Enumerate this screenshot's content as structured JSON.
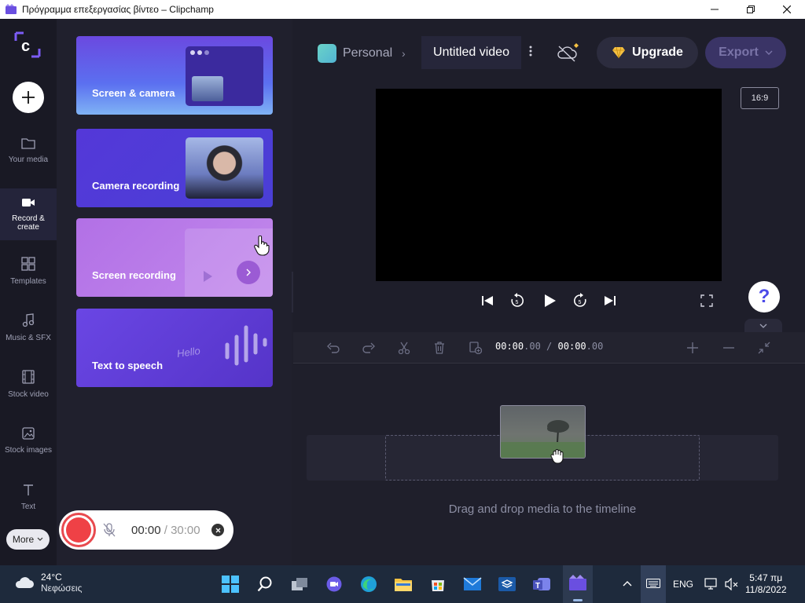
{
  "window": {
    "title": "Πρόγραμμα επεξεργασίας βίντεο – Clipchamp"
  },
  "nav": {
    "items": [
      {
        "label": "Your media",
        "icon": "folder-icon"
      },
      {
        "label_line1": "Record &",
        "label_line2": "create",
        "icon": "video-camera-icon"
      },
      {
        "label": "Templates",
        "icon": "templates-icon"
      },
      {
        "label": "Music & SFX",
        "icon": "music-note-icon"
      },
      {
        "label": "Stock video",
        "icon": "film-icon"
      },
      {
        "label": "Stock images",
        "icon": "image-icon"
      },
      {
        "label": "Text",
        "icon": "text-icon"
      }
    ],
    "more_label": "More"
  },
  "panel": {
    "cards": [
      {
        "label": "Screen & camera"
      },
      {
        "label": "Camera recording"
      },
      {
        "label": "Screen recording"
      },
      {
        "label": "Text to speech",
        "decor_text": "Hello"
      }
    ]
  },
  "header": {
    "workspace": "Personal",
    "breadcrumb_sep": "›",
    "project_title": "Untitled video",
    "upgrade_label": "Upgrade",
    "export_label": "Export"
  },
  "preview": {
    "aspect_ratio": "16:9",
    "help_glyph": "?"
  },
  "timeline": {
    "current_time": "00:00",
    "current_frac": ".00",
    "separator": "/",
    "total_time": "00:00",
    "total_frac": ".00",
    "drop_hint": "Drag and drop media to the timeline"
  },
  "recorder": {
    "elapsed": "00:00",
    "separator": "/",
    "limit": "30:00"
  },
  "taskbar": {
    "temperature": "24°C",
    "weather_text": "Νεφώσεις",
    "language": "ENG",
    "time": "5:47 πμ",
    "date": "11/8/2022"
  },
  "colors": {
    "accent": "#7c5cf6",
    "record_red": "#ef4146",
    "upgrade_gem": "#f6c142",
    "help_blue": "#4b4ae8"
  }
}
